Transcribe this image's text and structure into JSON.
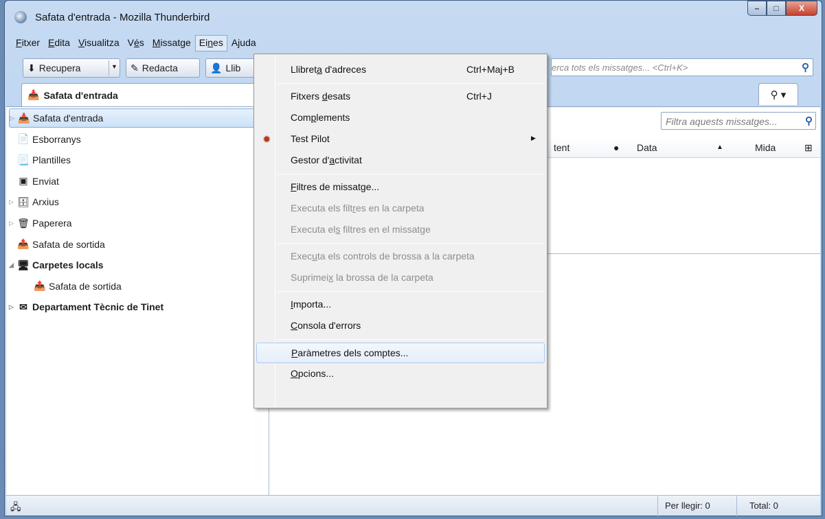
{
  "window": {
    "title": "Safata d'entrada - Mozilla Thunderbird",
    "controls": {
      "minimize": "–",
      "maximize": "□",
      "close": "X"
    }
  },
  "menubar": [
    {
      "pre": "",
      "key": "F",
      "post": "itxer"
    },
    {
      "pre": "",
      "key": "E",
      "post": "dita"
    },
    {
      "pre": "",
      "key": "V",
      "post": "isualitza"
    },
    {
      "pre": "V",
      "key": "é",
      "post": "s"
    },
    {
      "pre": "",
      "key": "M",
      "post": "issatge"
    },
    {
      "pre": "Ei",
      "key": "n",
      "post": "es"
    },
    {
      "pre": "",
      "key": "",
      "post": "Ajuda"
    }
  ],
  "toolbar": {
    "get_messages": "Recupera",
    "write": "Redacta",
    "address_book": "Llib",
    "search_placeholder": "erca tots els missatges... <Ctrl+K>"
  },
  "tab": {
    "label": "Safata d'entrada"
  },
  "folders": [
    {
      "label": "Safata d'entrada",
      "icon": "inbox-icon",
      "glyph": "📥",
      "twisty": "▷",
      "indent": 0,
      "selected": true,
      "bold": false
    },
    {
      "label": "Esborranys",
      "icon": "drafts-icon",
      "glyph": "📄",
      "twisty": "",
      "indent": 0,
      "selected": false,
      "bold": false
    },
    {
      "label": "Plantilles",
      "icon": "templates-icon",
      "glyph": "📃",
      "twisty": "",
      "indent": 0,
      "selected": false,
      "bold": false
    },
    {
      "label": "Enviat",
      "icon": "sent-icon",
      "glyph": "▣",
      "twisty": "",
      "indent": 0,
      "selected": false,
      "bold": false
    },
    {
      "label": "Arxius",
      "icon": "archive-icon",
      "glyph": "🗄",
      "twisty": "▷",
      "indent": 0,
      "selected": false,
      "bold": false
    },
    {
      "label": "Paperera",
      "icon": "trash-icon",
      "glyph": "🗑",
      "twisty": "▷",
      "indent": 0,
      "selected": false,
      "bold": false
    },
    {
      "label": "Safata de sortida",
      "icon": "outbox-icon",
      "glyph": "📤",
      "twisty": "",
      "indent": 0,
      "selected": false,
      "bold": false
    },
    {
      "label": "Carpetes locals",
      "icon": "local-folders-icon",
      "glyph": "🖥",
      "twisty": "◢",
      "indent": 0,
      "selected": false,
      "bold": true
    },
    {
      "label": "Safata de sortida",
      "icon": "outbox-icon",
      "glyph": "📤",
      "twisty": "",
      "indent": 1,
      "selected": false,
      "bold": false
    },
    {
      "label": "Departament Tècnic de Tinet",
      "icon": "mail-account-icon",
      "glyph": "✉",
      "twisty": "▷",
      "indent": 0,
      "selected": false,
      "bold": true
    }
  ],
  "list": {
    "filter_placeholder": "Filtra aquests missatges...",
    "columns": {
      "correspondent_partial": "tent",
      "date": "Data",
      "size": "Mida"
    }
  },
  "dropdown": [
    {
      "type": "item",
      "pre": "Llibret",
      "key": "a",
      "post": " d'adreces",
      "shortcut": "Ctrl+Maj+B",
      "disabled": false
    },
    {
      "type": "sep"
    },
    {
      "type": "item",
      "pre": "Fitxers ",
      "key": "d",
      "post": "esats",
      "shortcut": "Ctrl+J",
      "disabled": false
    },
    {
      "type": "item",
      "pre": "Com",
      "key": "p",
      "post": "lements",
      "shortcut": "",
      "disabled": false
    },
    {
      "type": "item",
      "pre": "Test Pilot",
      "key": "",
      "post": "",
      "shortcut": "",
      "disabled": false,
      "submenu": true,
      "icon": true
    },
    {
      "type": "item",
      "pre": "Gestor d'",
      "key": "a",
      "post": "ctivitat",
      "shortcut": "",
      "disabled": false
    },
    {
      "type": "sep"
    },
    {
      "type": "item",
      "pre": "",
      "key": "F",
      "post": "iltres de missatge...",
      "shortcut": "",
      "disabled": false
    },
    {
      "type": "item",
      "pre": "Executa els filt",
      "key": "r",
      "post": "es en la carpeta",
      "shortcut": "",
      "disabled": true
    },
    {
      "type": "item",
      "pre": "Executa el",
      "key": "s",
      "post": " filtres en el missatge",
      "shortcut": "",
      "disabled": true
    },
    {
      "type": "sep"
    },
    {
      "type": "item",
      "pre": "Exec",
      "key": "u",
      "post": "ta els controls de brossa a la carpeta",
      "shortcut": "",
      "disabled": true
    },
    {
      "type": "item",
      "pre": "Suprimei",
      "key": "x",
      "post": " la brossa de la carpeta",
      "shortcut": "",
      "disabled": true
    },
    {
      "type": "sep"
    },
    {
      "type": "item",
      "pre": "",
      "key": "I",
      "post": "mporta...",
      "shortcut": "",
      "disabled": false
    },
    {
      "type": "item",
      "pre": "",
      "key": "C",
      "post": "onsola d'errors",
      "shortcut": "",
      "disabled": false
    },
    {
      "type": "sep"
    },
    {
      "type": "item",
      "pre": "",
      "key": "P",
      "post": "aràmetres dels comptes...",
      "shortcut": "",
      "disabled": false,
      "hover": true
    },
    {
      "type": "item",
      "pre": "",
      "key": "O",
      "post": "pcions...",
      "shortcut": "",
      "disabled": false
    }
  ],
  "status": {
    "unread": "Per llegir: 0",
    "total": "Total: 0"
  }
}
